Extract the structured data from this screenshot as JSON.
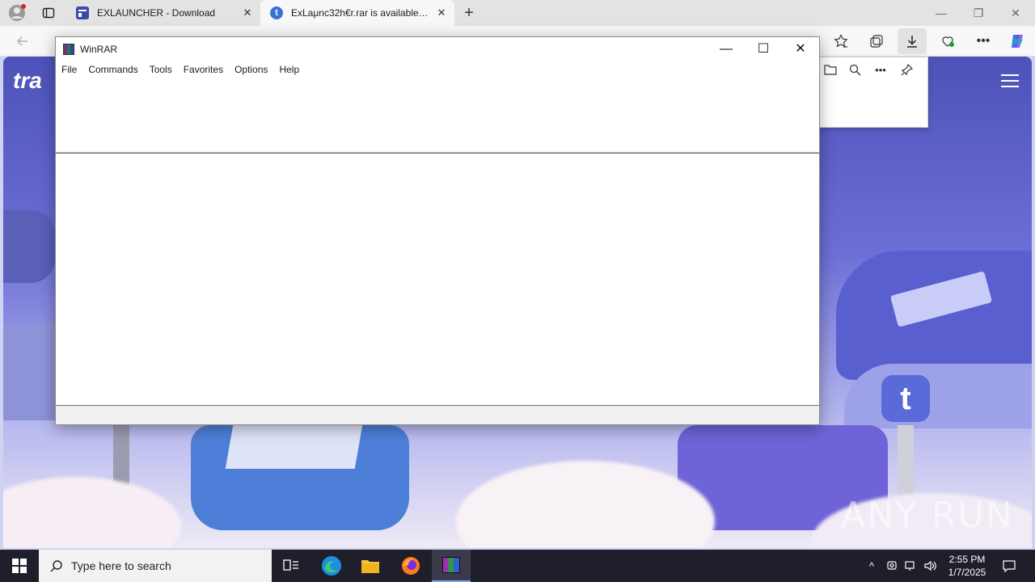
{
  "browser": {
    "tabs": [
      {
        "title": "EXLAUNCHER - Download",
        "active": false
      },
      {
        "title": "ExLaμnc32h€r.rar is available for d",
        "active": true
      }
    ],
    "new_tab_icon": "plus-icon"
  },
  "page": {
    "brand_partial": "tra",
    "watermark": "ANY RUN"
  },
  "winrar": {
    "title": "WinRAR",
    "menu": [
      "File",
      "Commands",
      "Tools",
      "Favorites",
      "Options",
      "Help"
    ]
  },
  "taskbar": {
    "search_placeholder": "Type here to search",
    "time": "2:55 PM",
    "date": "1/7/2025"
  },
  "colors": {
    "taskbar": "#1f1f2b",
    "page_accent": "#4d52b8",
    "winrar_icon": "#7a2a8c"
  }
}
